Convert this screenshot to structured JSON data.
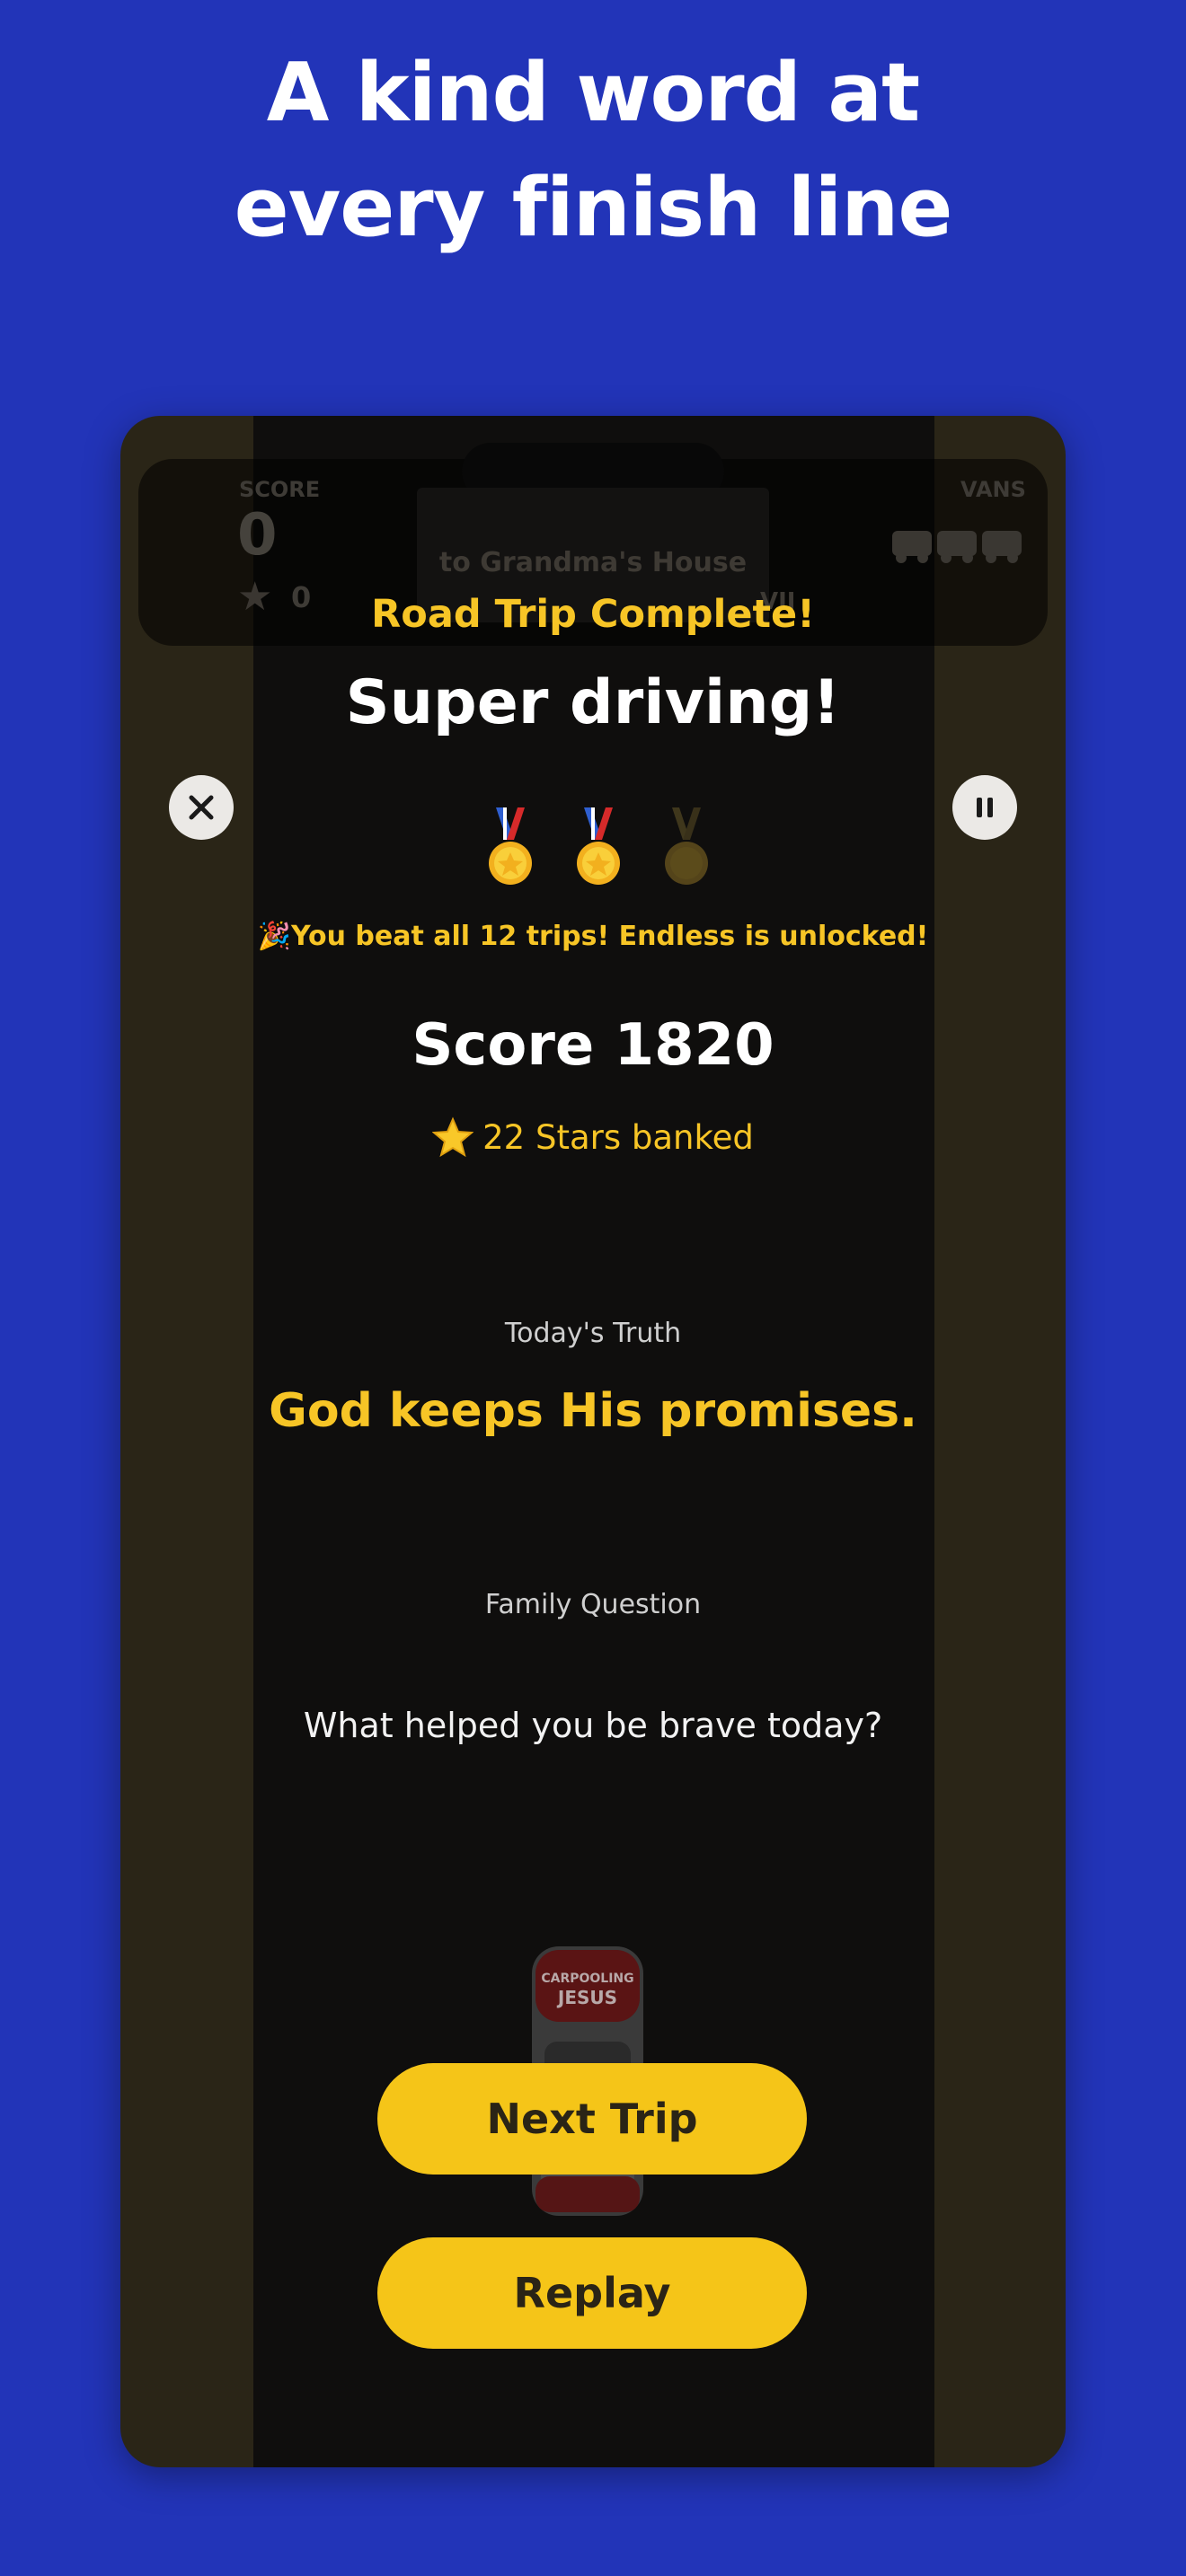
{
  "headline": {
    "line1": "A kind word at",
    "line2": "every finish line"
  },
  "hud": {
    "score_label": "SCORE",
    "score_value": "0",
    "stars_value": "0",
    "vans_label": "VANS",
    "destination": "to Grandma's House",
    "sign_fragment": "VII"
  },
  "modal": {
    "banner": "Road Trip Complete!",
    "title": "Super driving!",
    "unlock_message": "🎉You beat all 12 trips! Endless is unlocked!",
    "score_text": "Score 1820",
    "stars_banked": "22 Stars banked",
    "truth_label": "Today's Truth",
    "truth_text": "God keeps His promises.",
    "question_label": "Family Question",
    "question_text": "What helped you be brave today?",
    "medals_earned": 2,
    "medals_total": 3
  },
  "buttons": {
    "next_trip": "Next Trip",
    "replay": "Replay"
  },
  "car": {
    "line1": "CARPOOLING",
    "line2": "JESUS"
  },
  "icons": {
    "close": "close-icon",
    "pause": "pause-icon",
    "star": "star-icon",
    "medal": "medal-icon",
    "van": "van-icon"
  },
  "colors": {
    "background": "#2234b8",
    "accent_yellow": "#f5c518",
    "banner_yellow": "#f7c526",
    "road": "#0f0e0d",
    "shoulder": "#2a2517"
  }
}
